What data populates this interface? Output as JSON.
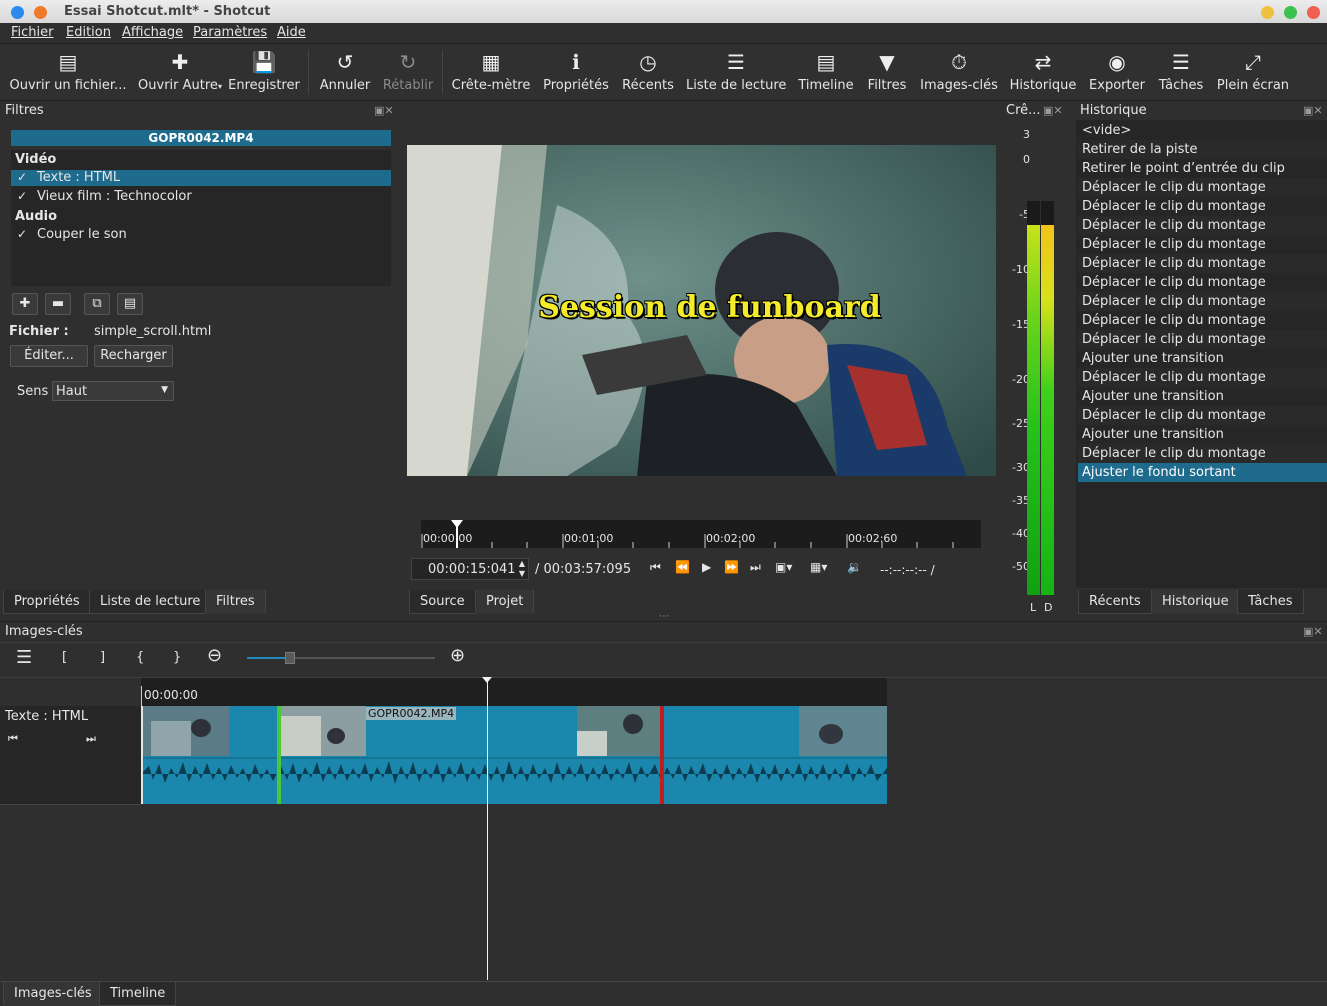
{
  "window": {
    "title": "Essai Shotcut.mlt* - Shotcut"
  },
  "menu": [
    "Fichier",
    "Edition",
    "Affichage",
    "Paramètres",
    "Aide"
  ],
  "toolbar": {
    "open": "Ouvrir un fichier...",
    "open_other": "Ouvrir Autre",
    "save": "Enregistrer",
    "undo": "Annuler",
    "redo": "Rétablir",
    "peak": "Crête-mètre",
    "properties": "Propriétés",
    "recent": "Récents",
    "playlist": "Liste de lecture",
    "timeline": "Timeline",
    "filters": "Filtres",
    "keyframes": "Images-clés",
    "history": "Historique",
    "export": "Exporter",
    "jobs": "Tâches",
    "fullscreen": "Plein écran"
  },
  "filters_panel": {
    "header": "Filtres",
    "clip_name": "GOPR0042.MP4",
    "video_header": "Vidéo",
    "video_filters": [
      "Texte : HTML",
      "Vieux film : Technocolor"
    ],
    "audio_header": "Audio",
    "audio_filters": [
      "Couper le son"
    ],
    "check": "✓",
    "file_label": "Fichier :",
    "file_value": "simple_scroll.html",
    "edit_button": "Éditer...",
    "reload_button": "Recharger",
    "direction_label": "Sens",
    "direction_value": "Haut",
    "tabs": [
      "Propriétés",
      "Liste de lecture",
      "Filtres"
    ]
  },
  "player": {
    "overlay_text": "Session de funboard",
    "ruler_ticks": [
      "00:00:00",
      "00:01:00",
      "00:02:00",
      "00:02:60"
    ],
    "timecode": "00:00:15:041",
    "duration": "/ 00:03:57:095",
    "inout": "--:--:--:-- /",
    "tabs": [
      "Source",
      "Projet"
    ]
  },
  "meter": {
    "header": "Crê...",
    "labels": [
      "3",
      "0",
      "-5",
      "-10",
      "-15",
      "-20",
      "-25",
      "-30",
      "-35",
      "-40",
      "-50"
    ],
    "channels": [
      "L",
      "D"
    ],
    "level_left": 0.94,
    "level_right": 0.94
  },
  "history": {
    "header": "Historique",
    "items": [
      "<vide>",
      "Retirer de la piste",
      "Retirer le point d’entrée du clip",
      "Déplacer le clip du montage",
      "Déplacer le clip du montage",
      "Déplacer le clip du montage",
      "Déplacer le clip du montage",
      "Déplacer le clip du montage",
      "Déplacer le clip du montage",
      "Déplacer le clip du montage",
      "Déplacer le clip du montage",
      "Déplacer le clip du montage",
      "Ajouter une transition",
      "Déplacer le clip du montage",
      "Ajouter une transition",
      "Déplacer le clip du montage",
      "Ajouter une transition",
      "Déplacer le clip du montage",
      "Ajuster le fondu sortant"
    ],
    "selected_index": 18,
    "tabs": [
      "Récents",
      "Historique",
      "Tâches"
    ]
  },
  "keyframes": {
    "header": "Images-clés",
    "toolbar_glyphs": [
      "☰",
      "[",
      "]",
      "{",
      "}"
    ],
    "ruler_time": "00:00:00",
    "track_label": "Texte : HTML",
    "clip_label": "GOPR0042.MP4",
    "zoom_level": 0.2,
    "tabs": [
      "Images-clés",
      "Timeline"
    ]
  },
  "colors": {
    "accent": "#1f6b8e",
    "clip": "#1b87ad",
    "selection": "#1f6b8e"
  }
}
